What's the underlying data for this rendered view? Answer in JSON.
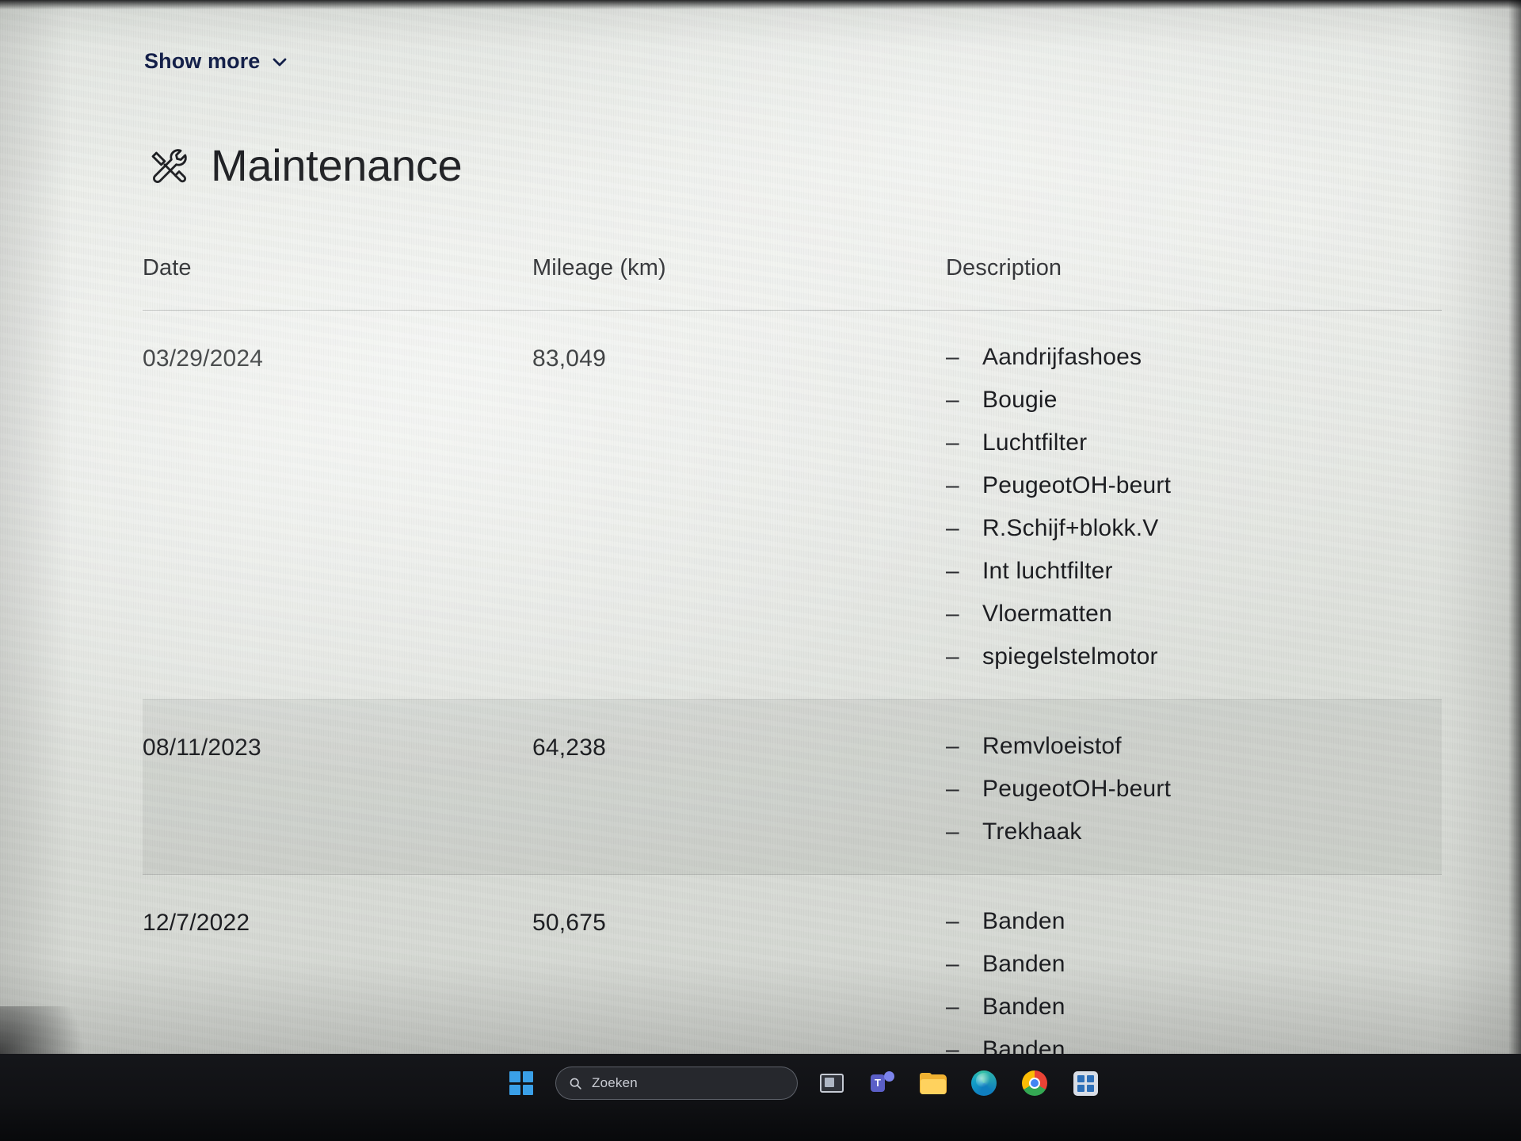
{
  "show_more": {
    "label": "Show more",
    "chevron_icon": "chevron-down-icon"
  },
  "section": {
    "icon": "tools-wrench-screwdriver-icon",
    "title": "Maintenance"
  },
  "table": {
    "columns": [
      "Date",
      "Mileage (km)",
      "Description"
    ],
    "rows": [
      {
        "date": "03/29/2024",
        "mileage": "83,049",
        "description": [
          "Aandrijfashoes",
          "Bougie",
          "Luchtfilter",
          "PeugeotOH-beurt",
          "R.Schijf+blokk.V",
          "Int luchtfilter",
          "Vloermatten",
          "spiegelstelmotor"
        ]
      },
      {
        "date": "08/11/2023",
        "mileage": "64,238",
        "description": [
          "Remvloeistof",
          "PeugeotOH-beurt",
          "Trekhaak"
        ]
      },
      {
        "date": "12/7/2022",
        "mileage": "50,675",
        "description": [
          "Banden",
          "Banden",
          "Banden",
          "Banden"
        ]
      }
    ],
    "bullet_dash": "–"
  },
  "taskbar": {
    "start_icon": "windows-start-icon",
    "search": {
      "icon": "search-icon",
      "placeholder": "Zoeken",
      "value": ""
    },
    "apps": [
      {
        "name": "task-view-icon",
        "label": "Task view"
      },
      {
        "name": "teams-icon",
        "label": "Microsoft Teams"
      },
      {
        "name": "file-explorer-icon",
        "label": "File Explorer"
      },
      {
        "name": "edge-icon",
        "label": "Microsoft Edge"
      },
      {
        "name": "chrome-icon",
        "label": "Google Chrome"
      },
      {
        "name": "microsoft-store-icon",
        "label": "Microsoft Store"
      }
    ]
  },
  "colors": {
    "link_accent": "#14204a",
    "text": "#1d1e22",
    "page_bg": "#e2e5e0",
    "row_alt_bg": "#cfd4cf",
    "taskbar_bg": "#101114"
  }
}
